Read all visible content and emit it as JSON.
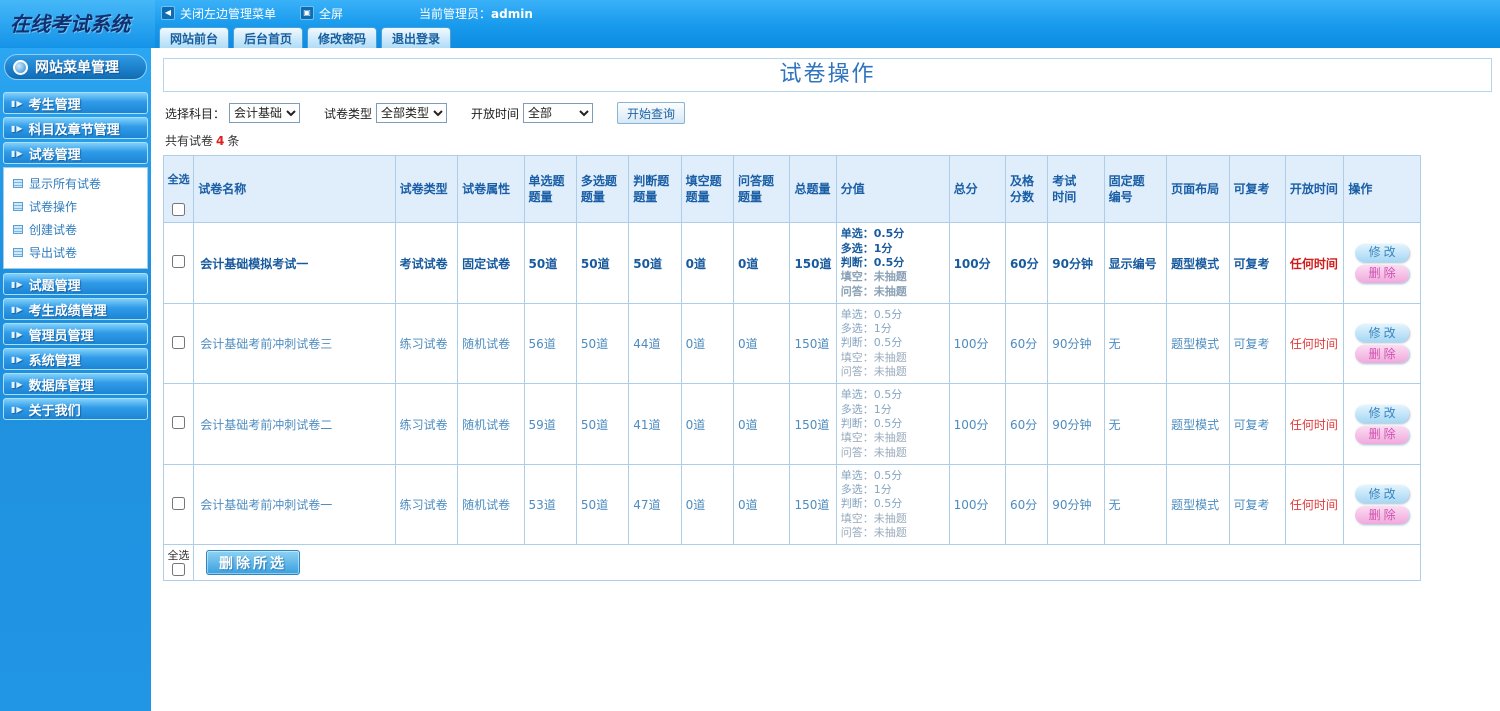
{
  "theme": {
    "accent_blue": "#1f8fdd",
    "alert_red": "#e02a2a",
    "header_bg": "#e0edfa"
  },
  "icons": {
    "collapse": "◀",
    "fullscreen": "▣",
    "menu_arrow": "▮▶"
  },
  "topbar": {
    "logo_text": "在线考试系统",
    "toggle_menu_label": "关闭左边管理菜单",
    "fullscreen_label": "全屏",
    "admin_prefix": "当前管理员：",
    "admin_name": "admin",
    "tabs": [
      "网站前台",
      "后台首页",
      "修改密码",
      "退出登录"
    ]
  },
  "sidebar": {
    "title": "网站菜单管理",
    "items_top": [
      "考生管理",
      "科目及章节管理",
      "试卷管理"
    ],
    "submenu": [
      "显示所有试卷",
      "试卷操作",
      "创建试卷",
      "导出试卷"
    ],
    "items_bottom": [
      "试题管理",
      "考生成绩管理",
      "管理员管理",
      "系统管理",
      "数据库管理",
      "关于我们"
    ]
  },
  "main": {
    "title": "试卷操作",
    "filters": {
      "subject_label": "选择科目：",
      "subject_value": "会计基础",
      "type_label": "试卷类型",
      "type_value": "全部类型",
      "time_label": "开放时间",
      "time_value": "全部",
      "search_button": "开始查询"
    },
    "summary": {
      "prefix": "共有试卷",
      "count": "4",
      "suffix": "条"
    },
    "table": {
      "headers": [
        "全选",
        "试卷名称",
        "试卷类型",
        "试卷属性",
        "单选题\n题量",
        "多选题\n题量",
        "判断题\n题量",
        "填空题\n题量",
        "问答题\n题量",
        "总题量",
        "分值",
        "总分",
        "及格\n分数",
        "考试\n时间",
        "固定题\n编号",
        "页面布局",
        "可复考",
        "开放时间",
        "操作"
      ],
      "actions": {
        "edit_label": "修改",
        "delete_label": "删除"
      },
      "rows": [
        {
          "bold": true,
          "name": "会计基础模拟考试一",
          "type": "考试试卷",
          "attr": "固定试卷",
          "single": "50道",
          "multi": "50道",
          "judge": "50道",
          "blank": "0道",
          "qa": "0道",
          "total": "150道",
          "score_lines": [
            "单选：0.5分",
            "多选：1分",
            "判断：0.5分",
            "填空：未抽题",
            "问答：未抽题"
          ],
          "total_score": "100分",
          "pass_score": "60分",
          "exam_time": "90分钟",
          "fixed_no": "显示编号",
          "layout": "题型模式",
          "retake": "可复考",
          "open_time": "任何时间"
        },
        {
          "bold": false,
          "name": "会计基础考前冲刺试卷三",
          "type": "练习试卷",
          "attr": "随机试卷",
          "single": "56道",
          "multi": "50道",
          "judge": "44道",
          "blank": "0道",
          "qa": "0道",
          "total": "150道",
          "score_lines": [
            "单选：0.5分",
            "多选：1分",
            "判断：0.5分",
            "填空：未抽题",
            "问答：未抽题"
          ],
          "total_score": "100分",
          "pass_score": "60分",
          "exam_time": "90分钟",
          "fixed_no": "无",
          "layout": "题型模式",
          "retake": "可复考",
          "open_time": "任何时间"
        },
        {
          "bold": false,
          "name": "会计基础考前冲刺试卷二",
          "type": "练习试卷",
          "attr": "随机试卷",
          "single": "59道",
          "multi": "50道",
          "judge": "41道",
          "blank": "0道",
          "qa": "0道",
          "total": "150道",
          "score_lines": [
            "单选：0.5分",
            "多选：1分",
            "判断：0.5分",
            "填空：未抽题",
            "问答：未抽题"
          ],
          "total_score": "100分",
          "pass_score": "60分",
          "exam_time": "90分钟",
          "fixed_no": "无",
          "layout": "题型模式",
          "retake": "可复考",
          "open_time": "任何时间"
        },
        {
          "bold": false,
          "name": "会计基础考前冲刺试卷一",
          "type": "练习试卷",
          "attr": "随机试卷",
          "single": "53道",
          "multi": "50道",
          "judge": "47道",
          "blank": "0道",
          "qa": "0道",
          "total": "150道",
          "score_lines": [
            "单选：0.5分",
            "多选：1分",
            "判断：0.5分",
            "填空：未抽题",
            "问答：未抽题"
          ],
          "total_score": "100分",
          "pass_score": "60分",
          "exam_time": "90分钟",
          "fixed_no": "无",
          "layout": "题型模式",
          "retake": "可复考",
          "open_time": "任何时间"
        }
      ]
    },
    "footer": {
      "select_all_label": "全选",
      "delete_button": "删除所选"
    }
  }
}
